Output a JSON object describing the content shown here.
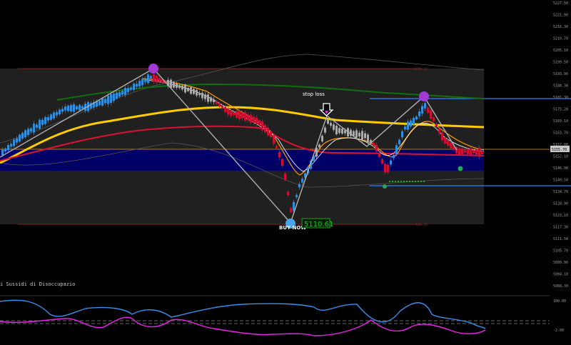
{
  "chart_data": {
    "type": "line",
    "price_axis": {
      "labels": [
        "5227.50",
        "5221.90",
        "5216.30",
        "5210.70",
        "5205.10",
        "5199.50",
        "5193.90",
        "5188.30",
        "5181.30",
        "5175.20",
        "5169.10",
        "5163.70",
        "5157.00",
        "5152.10",
        "5146.00",
        "5140.50",
        "5134.70",
        "5128.90",
        "5123.10",
        "5117.30",
        "5111.50",
        "5105.70",
        "5099.90",
        "5094.10",
        "5088.30"
      ],
      "ylim": [
        5088.3,
        5227.5
      ],
      "current_price": "5155.70"
    },
    "indicator_axis": {
      "labels": [
        "100.00",
        "-2.00"
      ],
      "ylim": [
        -2,
        100
      ]
    },
    "annotations": {
      "stop_loss": "stop loss",
      "buy_now": "BUY NOW",
      "buy_price": "5110.61",
      "indicator_title": "i Sussidi di Disoccupazio",
      "upper_line_label": "5196.60",
      "lower_line_label": "5118.60"
    },
    "series": [
      {
        "name": "",
        "color": "#1e90ff",
        "role": "price_axis_gridline"
      },
      {
        "name": "",
        "color": "#ffcc00",
        "role": "moving_average_slow"
      },
      {
        "name": "",
        "color": "#dd1133",
        "role": "moving_average_long"
      },
      {
        "name": "",
        "color": "#107010",
        "role": "moving_average_green"
      },
      {
        "name": "",
        "color": "#ff9900",
        "role": "moving_average_fast"
      },
      {
        "name": "",
        "color": "#1e90ff",
        "role": "oscillator_up"
      },
      {
        "name": "",
        "color": "#ee22ee",
        "role": "oscillator_down"
      }
    ],
    "colors": {
      "bull": "#2f8fdd",
      "bear": "#cc1133",
      "neutral": "#aaaaaa",
      "background": "#000000",
      "range_box": "#202020",
      "blue_zone": "#000066",
      "zigzag": "#b0b0b0"
    }
  }
}
